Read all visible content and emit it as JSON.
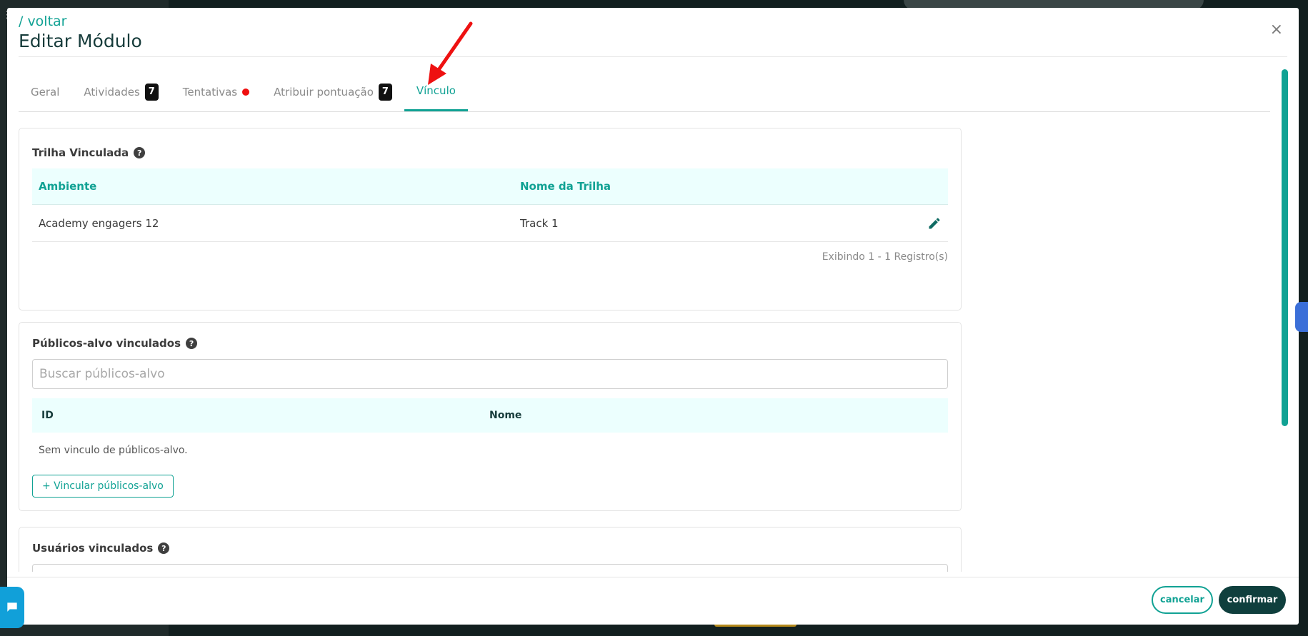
{
  "header": {
    "back_link": "/ voltar",
    "title": "Editar Módulo",
    "close_label": "×"
  },
  "tabs": [
    {
      "label": "Geral"
    },
    {
      "label": "Atividades",
      "badge": "7"
    },
    {
      "label": "Tentativas",
      "indicator": "red-dot"
    },
    {
      "label": "Atribuir pontuação",
      "badge": "7"
    },
    {
      "label": "Vínculo",
      "active": true
    }
  ],
  "trilha": {
    "title": "Trilha Vinculada",
    "columns": [
      "Ambiente",
      "Nome da Trilha"
    ],
    "rows": [
      {
        "ambiente": "Academy engagers 12",
        "nome": "Track 1"
      }
    ],
    "records": "Exibindo 1 - 1 Registro(s)"
  },
  "publicos": {
    "title": "Públicos-alvo vinculados",
    "search_placeholder": "Buscar públicos-alvo",
    "columns": [
      "ID",
      "Nome"
    ],
    "empty": "Sem vinculo de públicos-alvo.",
    "link_button": "+ Vincular públicos-alvo"
  },
  "usuarios": {
    "title": "Usuários vinculados"
  },
  "footer": {
    "cancel": "cancelar",
    "confirm": "confirmar"
  },
  "colors": {
    "accent": "#11a294",
    "dark": "#0f3f3d",
    "table_header_bg": "#ecfffe",
    "arrow": "#ee1111"
  },
  "icons": {
    "help": "question-circle-icon",
    "edit": "pencil-icon",
    "close": "close-icon",
    "chat": "chat-icon"
  }
}
